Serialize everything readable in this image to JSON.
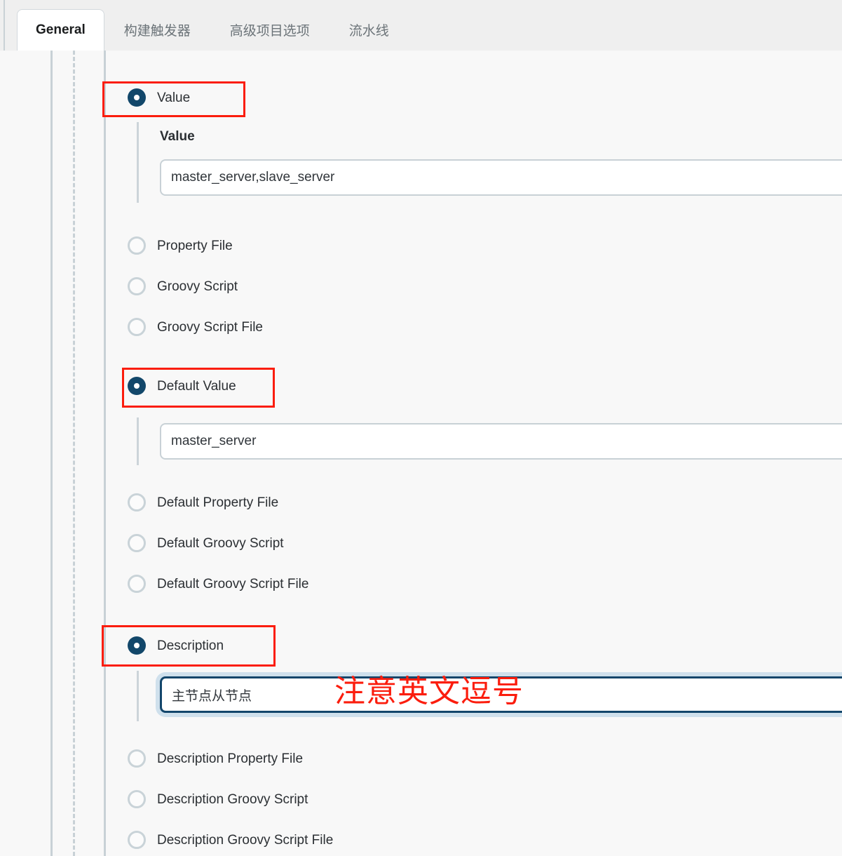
{
  "tabs": [
    {
      "label": "General",
      "active": true
    },
    {
      "label": "构建触发器",
      "active": false
    },
    {
      "label": "高级项目选项",
      "active": false
    },
    {
      "label": "流水线",
      "active": false
    }
  ],
  "options": {
    "value": "Value",
    "property_file": "Property File",
    "groovy_script": "Groovy Script",
    "groovy_script_file": "Groovy Script File",
    "default_value": "Default Value",
    "default_property_file": "Default Property File",
    "default_groovy_script": "Default Groovy Script",
    "default_groovy_script_file": "Default Groovy Script File",
    "description": "Description",
    "description_property_file": "Description Property File",
    "description_groovy_script": "Description Groovy Script",
    "description_groovy_script_file": "Description Groovy Script File"
  },
  "fields": {
    "value_label": "Value",
    "value_input": "master_server,slave_server",
    "default_value_input": "master_server",
    "description_input": "主节点从节点"
  },
  "annotation": {
    "text": "注意英文逗号",
    "color": "#fb1d0d"
  },
  "colors": {
    "radio_selected": "#12476a",
    "radio_unselected_border": "#c9d3d8",
    "highlight_box": "#fb1d0d",
    "focus_border": "#13466b",
    "focus_glow": "#cfe0ec",
    "page_bg": "#f8f8f8",
    "tabbar_bg": "#efefef",
    "guide_line": "#c8d1d6"
  }
}
